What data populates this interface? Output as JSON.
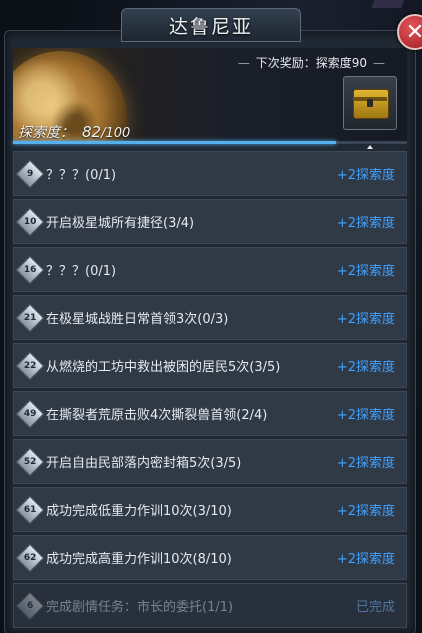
{
  "title": "达鲁尼亚",
  "close_symbol": "✕",
  "next_reward": {
    "text": "下次奖励：探索度90"
  },
  "exploration": {
    "label": "探索度：",
    "current": "82",
    "total": "/100",
    "progress": 0.82
  },
  "tasks": [
    {
      "num": "9",
      "text": "？？？(0/1)",
      "reward": "+2探索度",
      "done": false
    },
    {
      "num": "10",
      "text": "开启极星城所有捷径(3/4)",
      "reward": "+2探索度",
      "done": false
    },
    {
      "num": "16",
      "text": "？？？(0/1)",
      "reward": "+2探索度",
      "done": false
    },
    {
      "num": "21",
      "text": "在极星城战胜日常首领3次(0/3)",
      "reward": "+2探索度",
      "done": false
    },
    {
      "num": "22",
      "text": "从燃烧的工坊中救出被困的居民5次(3/5)",
      "reward": "+2探索度",
      "done": false
    },
    {
      "num": "49",
      "text": "在撕裂者荒原击败4次撕裂兽首领(2/4)",
      "reward": "+2探索度",
      "done": false
    },
    {
      "num": "52",
      "text": "开启自由民部落内密封箱5次(3/5)",
      "reward": "+2探索度",
      "done": false
    },
    {
      "num": "61",
      "text": "成功完成低重力作训10次(3/10)",
      "reward": "+2探索度",
      "done": false
    },
    {
      "num": "62",
      "text": "成功完成高重力作训10次(8/10)",
      "reward": "+2探索度",
      "done": false
    },
    {
      "num": "6",
      "text": "完成剧情任务：市长的委托(1/1)",
      "reward": "已完成",
      "done": true
    }
  ]
}
